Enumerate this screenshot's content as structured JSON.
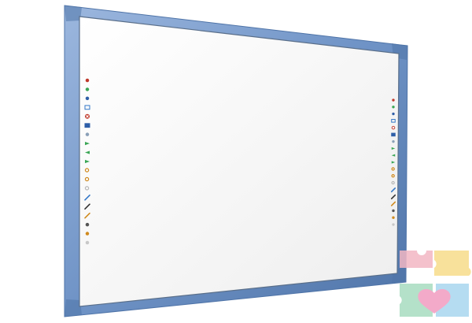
{
  "board": {
    "frame_color": "#6f93c6",
    "frame_highlight": "#9cb7de",
    "frame_shadow": "#4f74a8",
    "surface_color": "#f7f7f7"
  },
  "left_toolbar": {
    "icons": [
      {
        "name": "pointer-icon",
        "color": "#c0392b"
      },
      {
        "name": "home-icon",
        "color": "#3aa655"
      },
      {
        "name": "cup-icon",
        "color": "#2f5fa8"
      },
      {
        "name": "capture-icon",
        "color": "#3478c8"
      },
      {
        "name": "close-icon",
        "color": "#c0392b"
      },
      {
        "name": "window-icon",
        "color": "#2f5fa8"
      },
      {
        "name": "dot-icon",
        "color": "#8aa0b8"
      },
      {
        "name": "forward-icon",
        "color": "#3aa655"
      },
      {
        "name": "back-arrow-icon",
        "color": "#3aa655"
      },
      {
        "name": "next-arrow-icon",
        "color": "#3aa655"
      },
      {
        "name": "zoom-in-icon",
        "color": "#d08a1e"
      },
      {
        "name": "zoom-out-icon",
        "color": "#d08a1e"
      },
      {
        "name": "clock-icon",
        "color": "#b8b8b8"
      },
      {
        "name": "highlighter-icon",
        "color": "#3478c8"
      },
      {
        "name": "pen-icon",
        "color": "#333333"
      },
      {
        "name": "marker-icon",
        "color": "#d08a1e"
      },
      {
        "name": "undo-icon",
        "color": "#555555"
      },
      {
        "name": "eraser-icon",
        "color": "#d08a1e"
      },
      {
        "name": "settings-icon",
        "color": "#c8c8c8"
      }
    ]
  },
  "right_toolbar": {
    "icons": [
      {
        "name": "pointer-icon",
        "color": "#c0392b"
      },
      {
        "name": "home-icon",
        "color": "#3aa655"
      },
      {
        "name": "cup-icon",
        "color": "#2f5fa8"
      },
      {
        "name": "capture-icon",
        "color": "#3478c8"
      },
      {
        "name": "close-icon",
        "color": "#c0392b"
      },
      {
        "name": "window-icon",
        "color": "#2f5fa8"
      },
      {
        "name": "dot-icon",
        "color": "#8aa0b8"
      },
      {
        "name": "forward-icon",
        "color": "#3aa655"
      },
      {
        "name": "back-arrow-icon",
        "color": "#3aa655"
      },
      {
        "name": "next-arrow-icon",
        "color": "#3aa655"
      },
      {
        "name": "zoom-in-icon",
        "color": "#d08a1e"
      },
      {
        "name": "zoom-out-icon",
        "color": "#d08a1e"
      },
      {
        "name": "clock-icon",
        "color": "#b8b8b8"
      },
      {
        "name": "highlighter-icon",
        "color": "#3478c8"
      },
      {
        "name": "pen-icon",
        "color": "#333333"
      },
      {
        "name": "marker-icon",
        "color": "#d08a1e"
      },
      {
        "name": "undo-icon",
        "color": "#555555"
      },
      {
        "name": "eraser-icon",
        "color": "#d08a1e"
      },
      {
        "name": "settings-icon",
        "color": "#c8c8c8"
      }
    ]
  },
  "watermark": {
    "icon": "puzzle-heart-logo-icon",
    "colors": [
      "#f3b7c4",
      "#f7dc8a",
      "#a8dcc0",
      "#a9d6ef",
      "#f19cc0"
    ]
  }
}
